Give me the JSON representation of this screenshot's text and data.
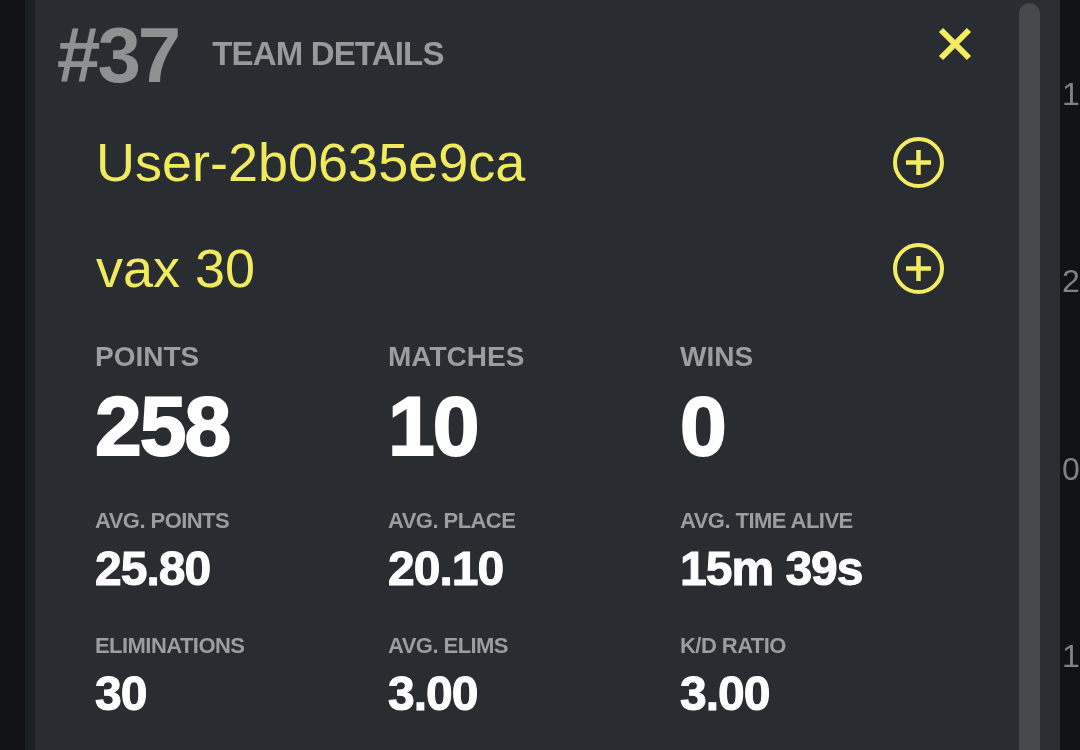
{
  "dialog": {
    "rank": "#37",
    "title": "TEAM DETAILS",
    "members": [
      {
        "name": "User-2b0635e9ca"
      },
      {
        "name": "vax 30"
      }
    ],
    "stats": [
      {
        "kind": "major",
        "label": "POINTS",
        "value": "258"
      },
      {
        "kind": "major",
        "label": "MATCHES",
        "value": "10"
      },
      {
        "kind": "major",
        "label": "WINS",
        "value": "0"
      },
      {
        "kind": "minor",
        "label": "AVG. POINTS",
        "value": "25.80"
      },
      {
        "kind": "minor",
        "label": "AVG. PLACE",
        "value": "20.10"
      },
      {
        "kind": "minor",
        "label": "AVG. TIME ALIVE",
        "value": "15m 39s"
      },
      {
        "kind": "minor",
        "label": "ELIMINATIONS",
        "value": "30"
      },
      {
        "kind": "minor",
        "label": "AVG. ELIMS",
        "value": "3.00"
      },
      {
        "kind": "minor",
        "label": "K/D RATIO",
        "value": "3.00"
      }
    ]
  },
  "background_rows": [
    {
      "column_1": "1"
    },
    {
      "column_1": "2"
    },
    {
      "column_1": "0"
    },
    {
      "column_1": "1"
    }
  ]
}
